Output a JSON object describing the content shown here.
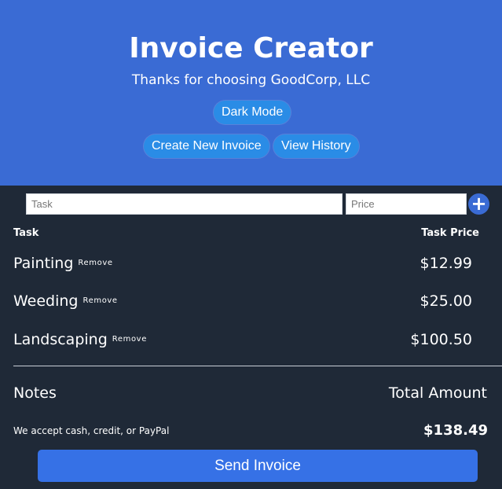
{
  "header": {
    "title": "Invoice Creator",
    "subtitle": "Thanks for choosing GoodCorp, LLC",
    "dark_mode_label": "Dark Mode",
    "create_new_label": "Create New Invoice",
    "view_history_label": "View History"
  },
  "form": {
    "task_placeholder": "Task",
    "price_placeholder": "Price",
    "add_icon": "plus-icon"
  },
  "table": {
    "task_header": "Task",
    "price_header": "Task Price",
    "remove_label": "Remove",
    "rows": [
      {
        "task": "Painting",
        "price": "$12.99"
      },
      {
        "task": "Weeding",
        "price": "$25.00"
      },
      {
        "task": "Landscaping",
        "price": "$100.50"
      }
    ]
  },
  "summary": {
    "notes_label": "Notes",
    "total_label": "Total Amount",
    "notes_text": "We accept cash, credit, or PayPal",
    "total_amount": "$138.49"
  },
  "send_label": "Send Invoice",
  "colors": {
    "header_bg": "#3a6bd4",
    "body_bg": "#1f2937",
    "pill_bg": "#2a8ce6",
    "send_button_bg": "#3671e6"
  }
}
